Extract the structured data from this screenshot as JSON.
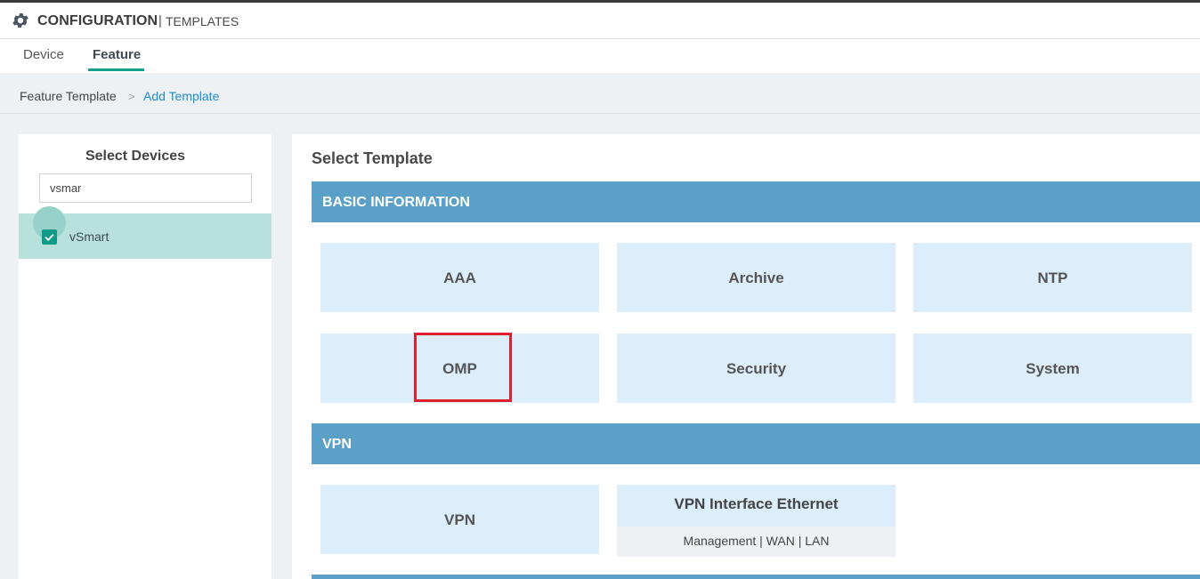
{
  "header": {
    "title": "CONFIGURATION",
    "separator": "|",
    "subtitle": "TEMPLATES"
  },
  "tabs": [
    {
      "label": "Device",
      "active": false
    },
    {
      "label": "Feature",
      "active": true
    }
  ],
  "breadcrumb": {
    "items": [
      "Feature Template",
      "Add Template"
    ],
    "separator": ">"
  },
  "devices": {
    "title": "Select Devices",
    "search_value": "vsmar",
    "items": [
      {
        "label": "vSmart",
        "checked": true
      }
    ]
  },
  "template": {
    "title": "Select Template",
    "sections": [
      {
        "label": "BASIC INFORMATION",
        "tiles": [
          "AAA",
          "Archive",
          "NTP",
          "OMP",
          "Security",
          "System"
        ]
      },
      {
        "label": "VPN",
        "tiles": [
          "VPN",
          "VPN Interface Ethernet"
        ],
        "subtitles": {
          "VPN Interface Ethernet": "Management | WAN | LAN"
        }
      }
    ]
  },
  "colors": {
    "accent": "#12a08a",
    "section_bar": "#5aa0c9",
    "tile": "#dcedfb",
    "link": "#1f8ad6",
    "highlight": "#e0202e"
  }
}
